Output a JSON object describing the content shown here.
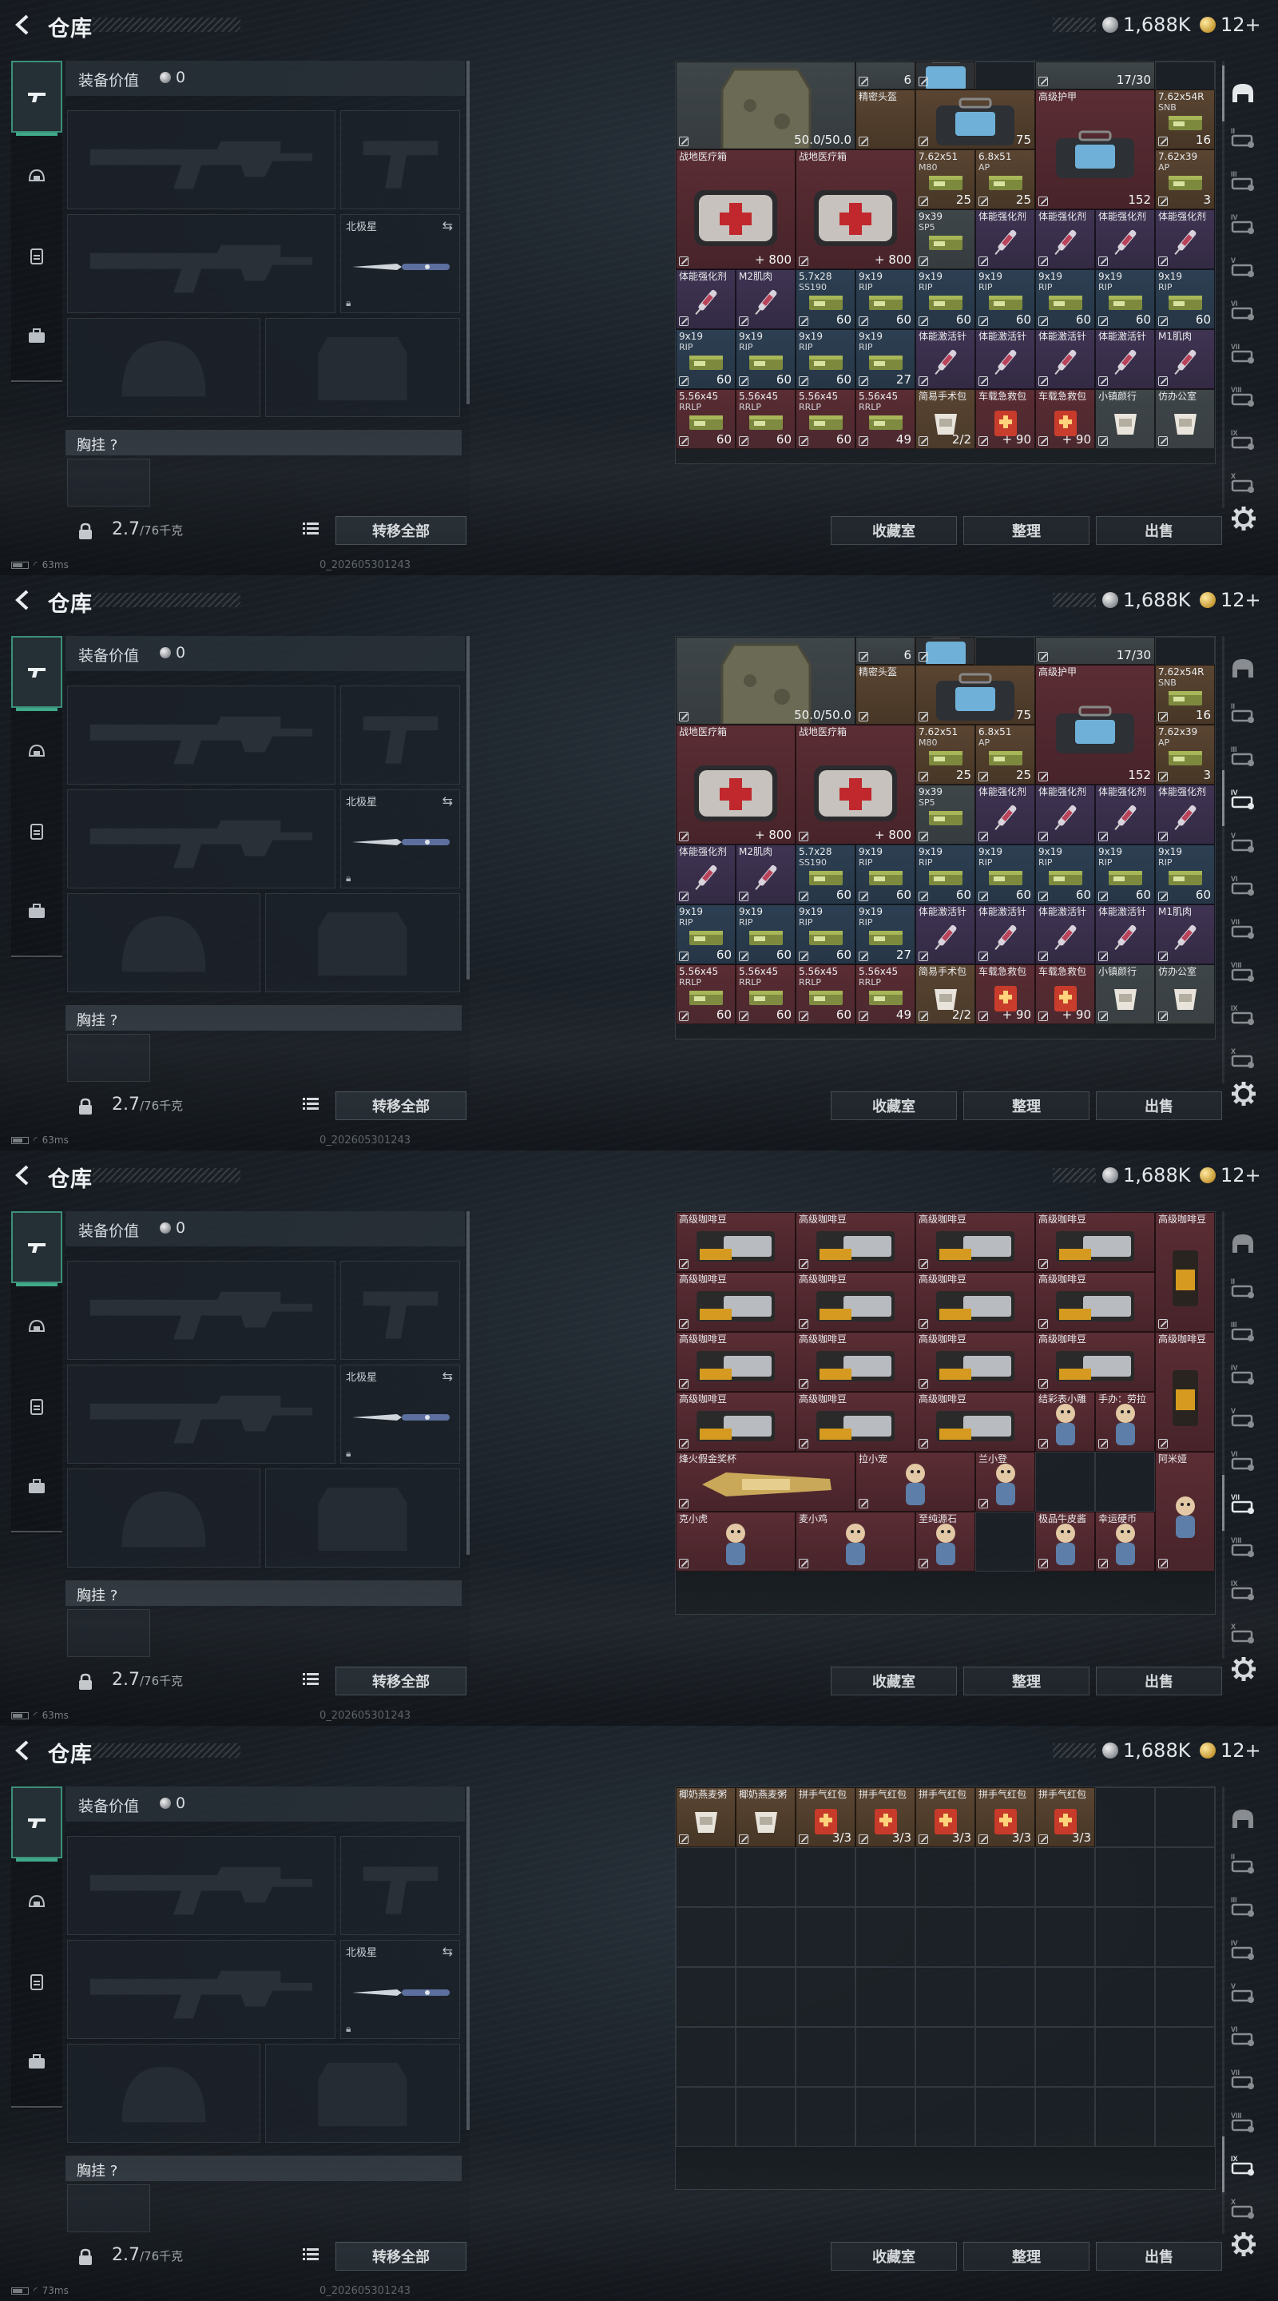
{
  "screens": [
    {
      "title": "仓库",
      "currency_silver": "1,688K",
      "currency_gold": "12+",
      "equip_title": "装备价值",
      "equip_value": "0",
      "melee_name": "北极星",
      "chest_label": "胸挂",
      "chest_q": "?",
      "weight": "2.7",
      "weight_max": "/76千克",
      "transfer_all": "转移全部",
      "btn_collection": "收藏室",
      "btn_organize": "整理",
      "btn_sell": "出售",
      "ping": "63ms",
      "build_id": "0_202605301243",
      "items": [
        {
          "c": 0,
          "r": 0,
          "w": 3,
          "h": 2,
          "bg": "g",
          "name": "",
          "count": "50.0/50.0",
          "art": "vest",
          "dy": -1
        },
        {
          "c": 3,
          "r": 0,
          "w": 1,
          "h": 1,
          "bg": "g",
          "name": "",
          "count": "6",
          "art": "none",
          "dy": -1
        },
        {
          "c": 3,
          "r": 1,
          "w": 1,
          "h": 1,
          "bg": "o",
          "name": "精密头盔",
          "count": "",
          "art": "none",
          "dy": -1
        },
        {
          "c": 4,
          "r": 0,
          "w": 1,
          "h": 1,
          "bg": "o",
          "name": "",
          "count": "",
          "art": "bag",
          "dy": -1
        },
        {
          "c": 6,
          "r": 0,
          "w": 2,
          "h": 1,
          "bg": "g",
          "name": "",
          "count": "17/30",
          "art": "none",
          "dy": -1
        },
        {
          "c": 4,
          "r": 1,
          "w": 2,
          "h": 1,
          "bg": "o",
          "name": "",
          "count": "75",
          "art": "bag",
          "dy": 0
        },
        {
          "c": 6,
          "r": 1,
          "w": 2,
          "h": 2,
          "bg": "r",
          "name": "高级护甲",
          "count": "152",
          "art": "bag",
          "dy": 0
        },
        {
          "c": 8,
          "r": 1,
          "w": 1,
          "h": 1,
          "bg": "o",
          "name": "7.62x54R",
          "sub": "SNB",
          "count": "16",
          "art": "ammo",
          "dy": 0
        },
        {
          "c": 0,
          "r": 2,
          "w": 2,
          "h": 2,
          "bg": "r",
          "name": "战地医疗箱",
          "count": "+ 800",
          "art": "med",
          "dy": 0
        },
        {
          "c": 2,
          "r": 2,
          "w": 2,
          "h": 2,
          "bg": "r",
          "name": "战地医疗箱",
          "count": "+ 800",
          "art": "med",
          "dy": 0
        },
        {
          "c": 4,
          "r": 2,
          "w": 1,
          "h": 1,
          "bg": "o",
          "name": "7.62x51",
          "sub": "M80",
          "count": "25",
          "art": "ammo",
          "dy": 0
        },
        {
          "c": 5,
          "r": 2,
          "w": 1,
          "h": 1,
          "bg": "o",
          "name": "6.8x51",
          "sub": "AP",
          "count": "25",
          "art": "ammo",
          "dy": 0
        },
        {
          "c": 8,
          "r": 2,
          "w": 1,
          "h": 1,
          "bg": "o",
          "name": "7.62x39",
          "sub": "AP",
          "count": "3",
          "art": "ammo",
          "dy": 0
        },
        {
          "c": 4,
          "r": 3,
          "w": 1,
          "h": 1,
          "bg": "g",
          "name": "9x39",
          "sub": "SP5",
          "count": "",
          "art": "ammo",
          "dy": 0
        },
        {
          "c": 5,
          "r": 3,
          "w": 1,
          "h": 1,
          "bg": "p",
          "name": "体能强化剂",
          "count": "",
          "art": "syr",
          "dy": 0
        },
        {
          "c": 6,
          "r": 3,
          "w": 1,
          "h": 1,
          "bg": "p",
          "name": "体能强化剂",
          "count": "",
          "art": "syr",
          "dy": 0
        },
        {
          "c": 7,
          "r": 3,
          "w": 1,
          "h": 1,
          "bg": "p",
          "name": "体能强化剂",
          "count": "",
          "art": "syr",
          "dy": 0
        },
        {
          "c": 8,
          "r": 3,
          "w": 1,
          "h": 1,
          "bg": "p",
          "name": "体能强化剂",
          "count": "",
          "art": "syr",
          "dy": 0
        },
        {
          "c": 0,
          "r": 4,
          "w": 1,
          "h": 1,
          "bg": "p",
          "name": "体能强化剂",
          "count": "",
          "art": "syr",
          "dy": 0
        },
        {
          "c": 1,
          "r": 4,
          "w": 1,
          "h": 1,
          "bg": "p",
          "name": "M2肌肉",
          "count": "",
          "art": "syr",
          "dy": 0
        },
        {
          "c": 2,
          "r": 4,
          "w": 1,
          "h": 1,
          "bg": "b",
          "name": "5.7x28",
          "sub": "SS190",
          "count": "60",
          "art": "ammo",
          "dy": 0
        },
        {
          "c": 3,
          "r": 4,
          "w": 1,
          "h": 1,
          "bg": "b",
          "name": "9x19",
          "sub": "RIP",
          "count": "60",
          "art": "ammo",
          "dy": 0
        },
        {
          "c": 4,
          "r": 4,
          "w": 1,
          "h": 1,
          "bg": "b",
          "name": "9x19",
          "sub": "RIP",
          "count": "60",
          "art": "ammo",
          "dy": 0
        },
        {
          "c": 5,
          "r": 4,
          "w": 1,
          "h": 1,
          "bg": "b",
          "name": "9x19",
          "sub": "RIP",
          "count": "60",
          "art": "ammo",
          "dy": 0
        },
        {
          "c": 6,
          "r": 4,
          "w": 1,
          "h": 1,
          "bg": "b",
          "name": "9x19",
          "sub": "RIP",
          "count": "60",
          "art": "ammo",
          "dy": 0
        },
        {
          "c": 7,
          "r": 4,
          "w": 1,
          "h": 1,
          "bg": "b",
          "name": "9x19",
          "sub": "RIP",
          "count": "60",
          "art": "ammo",
          "dy": 0
        },
        {
          "c": 8,
          "r": 4,
          "w": 1,
          "h": 1,
          "bg": "b",
          "name": "9x19",
          "sub": "RIP",
          "count": "60",
          "art": "ammo",
          "dy": 0
        },
        {
          "c": 0,
          "r": 5,
          "w": 1,
          "h": 1,
          "bg": "b",
          "name": "9x19",
          "sub": "RIP",
          "count": "60",
          "art": "ammo",
          "dy": 0
        },
        {
          "c": 1,
          "r": 5,
          "w": 1,
          "h": 1,
          "bg": "b",
          "name": "9x19",
          "sub": "RIP",
          "count": "60",
          "art": "ammo",
          "dy": 0
        },
        {
          "c": 2,
          "r": 5,
          "w": 1,
          "h": 1,
          "bg": "b",
          "name": "9x19",
          "sub": "RIP",
          "count": "60",
          "art": "ammo",
          "dy": 0
        },
        {
          "c": 3,
          "r": 5,
          "w": 1,
          "h": 1,
          "bg": "b",
          "name": "9x19",
          "sub": "RIP",
          "count": "27",
          "art": "ammo",
          "dy": 0
        },
        {
          "c": 4,
          "r": 5,
          "w": 1,
          "h": 1,
          "bg": "p",
          "name": "体能激活针",
          "count": "",
          "art": "syr",
          "dy": 0
        },
        {
          "c": 5,
          "r": 5,
          "w": 1,
          "h": 1,
          "bg": "p",
          "name": "体能激活针",
          "count": "",
          "art": "syr",
          "dy": 0
        },
        {
          "c": 6,
          "r": 5,
          "w": 1,
          "h": 1,
          "bg": "p",
          "name": "体能激活针",
          "count": "",
          "art": "syr",
          "dy": 0
        },
        {
          "c": 7,
          "r": 5,
          "w": 1,
          "h": 1,
          "bg": "p",
          "name": "体能激活针",
          "count": "",
          "art": "syr",
          "dy": 0
        },
        {
          "c": 8,
          "r": 5,
          "w": 1,
          "h": 1,
          "bg": "p",
          "name": "M1肌肉",
          "count": "",
          "art": "syr",
          "dy": 0
        },
        {
          "c": 0,
          "r": 6,
          "w": 1,
          "h": 1,
          "bg": "r",
          "name": "5.56x45",
          "sub": "RRLP",
          "count": "60",
          "art": "ammo",
          "dy": 0
        },
        {
          "c": 1,
          "r": 6,
          "w": 1,
          "h": 1,
          "bg": "r",
          "name": "5.56x45",
          "sub": "RRLP",
          "count": "60",
          "art": "ammo",
          "dy": 0
        },
        {
          "c": 2,
          "r": 6,
          "w": 1,
          "h": 1,
          "bg": "r",
          "name": "5.56x45",
          "sub": "RRLP",
          "count": "60",
          "art": "ammo",
          "dy": 0
        },
        {
          "c": 3,
          "r": 6,
          "w": 1,
          "h": 1,
          "bg": "r",
          "name": "5.56x45",
          "sub": "RRLP",
          "count": "49",
          "art": "ammo",
          "dy": 0
        },
        {
          "c": 4,
          "r": 6,
          "w": 1,
          "h": 1,
          "bg": "o",
          "name": "简易手术包",
          "count": "2/2",
          "art": "pouch",
          "dy": 0
        },
        {
          "c": 5,
          "r": 6,
          "w": 1,
          "h": 1,
          "bg": "r",
          "name": "车载急救包",
          "count": "+ 90",
          "art": "kit",
          "dy": 0
        },
        {
          "c": 6,
          "r": 6,
          "w": 1,
          "h": 1,
          "bg": "r",
          "name": "车载急救包",
          "count": "+ 90",
          "art": "kit",
          "dy": 0
        },
        {
          "c": 7,
          "r": 6,
          "w": 1,
          "h": 1,
          "bg": "g",
          "name": "小镇颜行",
          "count": "",
          "art": "pouch",
          "dy": 0
        },
        {
          "c": 8,
          "r": 6,
          "w": 1,
          "h": 1,
          "bg": "g",
          "name": "仿办公室",
          "count": "",
          "art": "pouch",
          "dy": 0
        }
      ]
    },
    {
      "title": "仓库",
      "currency_silver": "1,688K",
      "currency_gold": "12+",
      "equip_title": "装备价值",
      "equip_value": "0",
      "melee_name": "北极星",
      "chest_label": "胸挂",
      "chest_q": "?",
      "weight": "2.7",
      "weight_max": "/76千克",
      "transfer_all": "转移全部",
      "btn_collection": "收藏室",
      "btn_organize": "整理",
      "btn_sell": "出售",
      "ping": "63ms",
      "build_id": "0_202605301243",
      "items": []
    },
    {
      "title": "仓库",
      "currency_silver": "1,688K",
      "currency_gold": "12+",
      "equip_title": "装备价值",
      "equip_value": "0",
      "melee_name": "北极星",
      "chest_label": "胸挂",
      "chest_q": "?",
      "weight": "2.7",
      "weight_max": "/76千克",
      "transfer_all": "转移全部",
      "btn_collection": "收藏室",
      "btn_organize": "整理",
      "btn_sell": "出售",
      "ping": "63ms",
      "build_id": "0_202605301243",
      "items": [
        {
          "c": 0,
          "r": 0,
          "w": 2,
          "h": 1,
          "bg": "r",
          "name": "高级咖啡豆",
          "count": "",
          "art": "coffee",
          "dy": 0
        },
        {
          "c": 2,
          "r": 0,
          "w": 2,
          "h": 1,
          "bg": "r",
          "name": "高级咖啡豆",
          "count": "",
          "art": "coffee",
          "dy": 0
        },
        {
          "c": 4,
          "r": 0,
          "w": 2,
          "h": 1,
          "bg": "r",
          "name": "高级咖啡豆",
          "count": "",
          "art": "coffee",
          "dy": 0
        },
        {
          "c": 6,
          "r": 0,
          "w": 2,
          "h": 1,
          "bg": "r",
          "name": "高级咖啡豆",
          "count": "",
          "art": "coffee",
          "dy": 0
        },
        {
          "c": 8,
          "r": 0,
          "w": 1,
          "h": 2,
          "bg": "r",
          "name": "高级咖啡豆",
          "count": "",
          "art": "coffeebag",
          "dy": 0
        },
        {
          "c": 0,
          "r": 1,
          "w": 2,
          "h": 1,
          "bg": "r",
          "name": "高级咖啡豆",
          "count": "",
          "art": "coffee",
          "dy": 0
        },
        {
          "c": 2,
          "r": 1,
          "w": 2,
          "h": 1,
          "bg": "r",
          "name": "高级咖啡豆",
          "count": "",
          "art": "coffee",
          "dy": 0
        },
        {
          "c": 4,
          "r": 1,
          "w": 2,
          "h": 1,
          "bg": "r",
          "name": "高级咖啡豆",
          "count": "",
          "art": "coffee",
          "dy": 0
        },
        {
          "c": 6,
          "r": 1,
          "w": 2,
          "h": 1,
          "bg": "r",
          "name": "高级咖啡豆",
          "count": "",
          "art": "coffee",
          "dy": 0
        },
        {
          "c": 0,
          "r": 2,
          "w": 2,
          "h": 1,
          "bg": "r",
          "name": "高级咖啡豆",
          "count": "",
          "art": "coffee",
          "dy": 0
        },
        {
          "c": 2,
          "r": 2,
          "w": 2,
          "h": 1,
          "bg": "r",
          "name": "高级咖啡豆",
          "count": "",
          "art": "coffee",
          "dy": 0
        },
        {
          "c": 4,
          "r": 2,
          "w": 2,
          "h": 1,
          "bg": "r",
          "name": "高级咖啡豆",
          "count": "",
          "art": "coffee",
          "dy": 0
        },
        {
          "c": 6,
          "r": 2,
          "w": 2,
          "h": 1,
          "bg": "r",
          "name": "高级咖啡豆",
          "count": "",
          "art": "coffee",
          "dy": 0
        },
        {
          "c": 8,
          "r": 2,
          "w": 1,
          "h": 2,
          "bg": "r",
          "name": "高级咖啡豆",
          "count": "",
          "art": "coffeebag",
          "dy": 0
        },
        {
          "c": 0,
          "r": 3,
          "w": 2,
          "h": 1,
          "bg": "r",
          "name": "高级咖啡豆",
          "count": "",
          "art": "coffee",
          "dy": 0
        },
        {
          "c": 2,
          "r": 3,
          "w": 2,
          "h": 1,
          "bg": "r",
          "name": "高级咖啡豆",
          "count": "",
          "art": "coffee",
          "dy": 0
        },
        {
          "c": 4,
          "r": 3,
          "w": 2,
          "h": 1,
          "bg": "r",
          "name": "高级咖啡豆",
          "count": "",
          "art": "coffee",
          "dy": 0
        },
        {
          "c": 6,
          "r": 3,
          "w": 1,
          "h": 1,
          "bg": "r",
          "name": "结彩表小雕",
          "count": "",
          "art": "fig",
          "dy": 0
        },
        {
          "c": 7,
          "r": 3,
          "w": 1,
          "h": 1,
          "bg": "r",
          "name": "手办：劳拉",
          "count": "",
          "art": "fig",
          "dy": 0
        },
        {
          "c": 0,
          "r": 4,
          "w": 3,
          "h": 1,
          "bg": "r",
          "name": "烽火假金奖杯",
          "count": "",
          "art": "trophy",
          "dy": 0
        },
        {
          "c": 3,
          "r": 4,
          "w": 2,
          "h": 1,
          "bg": "r",
          "name": "拉小宠",
          "count": "",
          "art": "fig",
          "dy": 0
        },
        {
          "c": 5,
          "r": 4,
          "w": 1,
          "h": 1,
          "bg": "r",
          "name": "兰小登",
          "count": "",
          "art": "fig",
          "dy": 0
        },
        {
          "c": 8,
          "r": 4,
          "w": 1,
          "h": 2,
          "bg": "r",
          "name": "阿米娅",
          "count": "",
          "art": "fig",
          "dy": 0
        },
        {
          "c": 0,
          "r": 5,
          "w": 2,
          "h": 1,
          "bg": "r",
          "name": "克小虎",
          "count": "",
          "art": "fig",
          "dy": 0
        },
        {
          "c": 2,
          "r": 5,
          "w": 2,
          "h": 1,
          "bg": "r",
          "name": "麦小鸡",
          "count": "",
          "art": "fig",
          "dy": 0
        },
        {
          "c": 4,
          "r": 5,
          "w": 1,
          "h": 1,
          "bg": "r",
          "name": "至纯源石",
          "count": "",
          "art": "fig",
          "dy": 0
        },
        {
          "c": 6,
          "r": 5,
          "w": 1,
          "h": 1,
          "bg": "r",
          "name": "极品牛皮酱",
          "count": "",
          "art": "fig",
          "dy": 0
        },
        {
          "c": 7,
          "r": 5,
          "w": 1,
          "h": 1,
          "bg": "r",
          "name": "幸运硬币",
          "count": "",
          "art": "fig",
          "dy": 0
        }
      ]
    },
    {
      "title": "仓库",
      "currency_silver": "1,688K",
      "currency_gold": "12+",
      "equip_title": "装备价值",
      "equip_value": "0",
      "melee_name": "北极星",
      "chest_label": "胸挂",
      "chest_q": "?",
      "weight": "2.7",
      "weight_max": "/76千克",
      "transfer_all": "转移全部",
      "btn_collection": "收藏室",
      "btn_organize": "整理",
      "btn_sell": "出售",
      "ping": "73ms",
      "build_id": "0_202605301243",
      "items": [
        {
          "c": 0,
          "r": 0,
          "w": 1,
          "h": 1,
          "bg": "o",
          "name": "椰奶燕麦粥",
          "count": "",
          "art": "pouch",
          "dy": 0
        },
        {
          "c": 1,
          "r": 0,
          "w": 1,
          "h": 1,
          "bg": "o",
          "name": "椰奶燕麦粥",
          "count": "",
          "art": "pouch",
          "dy": 0
        },
        {
          "c": 2,
          "r": 0,
          "w": 1,
          "h": 1,
          "bg": "o",
          "name": "拼手气红包",
          "count": "3/3",
          "art": "kit",
          "dy": 0
        },
        {
          "c": 3,
          "r": 0,
          "w": 1,
          "h": 1,
          "bg": "o",
          "name": "拼手气红包",
          "count": "3/3",
          "art": "kit",
          "dy": 0
        },
        {
          "c": 4,
          "r": 0,
          "w": 1,
          "h": 1,
          "bg": "o",
          "name": "拼手气红包",
          "count": "3/3",
          "art": "kit",
          "dy": 0
        },
        {
          "c": 5,
          "r": 0,
          "w": 1,
          "h": 1,
          "bg": "o",
          "name": "拼手气红包",
          "count": "3/3",
          "art": "kit",
          "dy": 0
        },
        {
          "c": 6,
          "r": 0,
          "w": 1,
          "h": 1,
          "bg": "o",
          "name": "拼手气红包",
          "count": "3/3",
          "art": "kit",
          "dy": 0
        }
      ]
    }
  ],
  "right_bar_icons": [
    "helmet-tab-icon",
    "storage-ii-icon",
    "storage-iii-icon",
    "storage-iv-icon",
    "storage-v-icon",
    "storage-vi-icon",
    "storage-vii-icon",
    "storage-viii-icon",
    "storage-ix-icon",
    "storage-x-icon"
  ],
  "active_right_tab": [
    0,
    3,
    6,
    8
  ],
  "colors": {
    "accent": "#3fa98a",
    "rare_red": "#5b2d34",
    "epic_purple": "#3f3452",
    "blue": "#2d3f52",
    "orange": "#5a4532"
  }
}
